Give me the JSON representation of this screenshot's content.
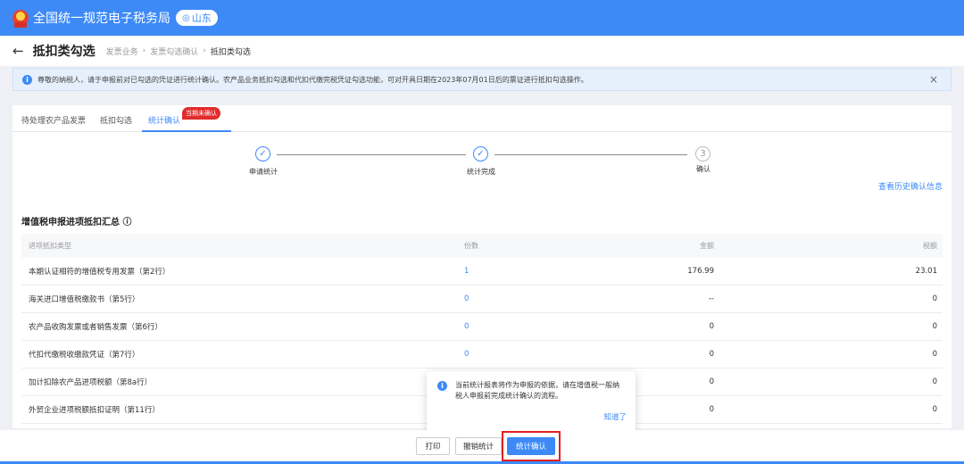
{
  "header": {
    "site_title": "全国统一规范电子税务局",
    "region": "山东"
  },
  "page": {
    "title": "抵扣类勾选",
    "breadcrumb": [
      "发票业务",
      "发票勾选确认",
      "抵扣类勾选"
    ]
  },
  "notice": {
    "text": "尊敬的纳税人，请于申报前对已勾选的凭证进行统计确认。农产品业务抵扣勾选和代扣代缴完税凭证勾选功能，可对开具日期在2023年07月01日后的票证进行抵扣勾选操作。"
  },
  "tabs": [
    {
      "label": "待处理农产品发票"
    },
    {
      "label": "抵扣勾选"
    },
    {
      "label": "统计确认",
      "badge": "当期未确认"
    }
  ],
  "steps": [
    {
      "label": "申请统计",
      "status": "done"
    },
    {
      "label": "统计完成",
      "status": "done"
    },
    {
      "label": "确认",
      "number": "3",
      "status": "pending"
    }
  ],
  "history_link": "查看历史确认信息",
  "summary": {
    "title": "增值税申报进项抵扣汇总",
    "columns": [
      "进项抵扣类型",
      "份数",
      "金额",
      "税额"
    ],
    "rows": [
      {
        "type": "本期认证相符的增值税专用发票（第2行）",
        "count": "1",
        "amount": "176.99",
        "tax": "23.01"
      },
      {
        "type": "海关进口增值税缴款书（第5行）",
        "count": "0",
        "amount": "--",
        "tax": "0"
      },
      {
        "type": "农产品收购发票或者销售发票（第6行）",
        "count": "0",
        "amount": "0",
        "tax": "0"
      },
      {
        "type": "代扣代缴税收缴款凭证（第7行）",
        "count": "0",
        "amount": "0",
        "tax": "0"
      },
      {
        "type": "加计扣除农产品进项税额（第8a行）",
        "count": "",
        "amount": "0",
        "tax": "0"
      },
      {
        "type": "外贸企业进项税额抵扣证明（第11行）",
        "count": "",
        "amount": "0",
        "tax": "0"
      }
    ]
  },
  "popover": {
    "text": "当前统计报表将作为申报的依据，请在增值税一般纳税人申报前完成统计确认的流程。",
    "confirm": "知道了"
  },
  "footer": {
    "print": "打印",
    "cancel_stat": "撤销统计",
    "confirm_stat": "统计确认"
  }
}
